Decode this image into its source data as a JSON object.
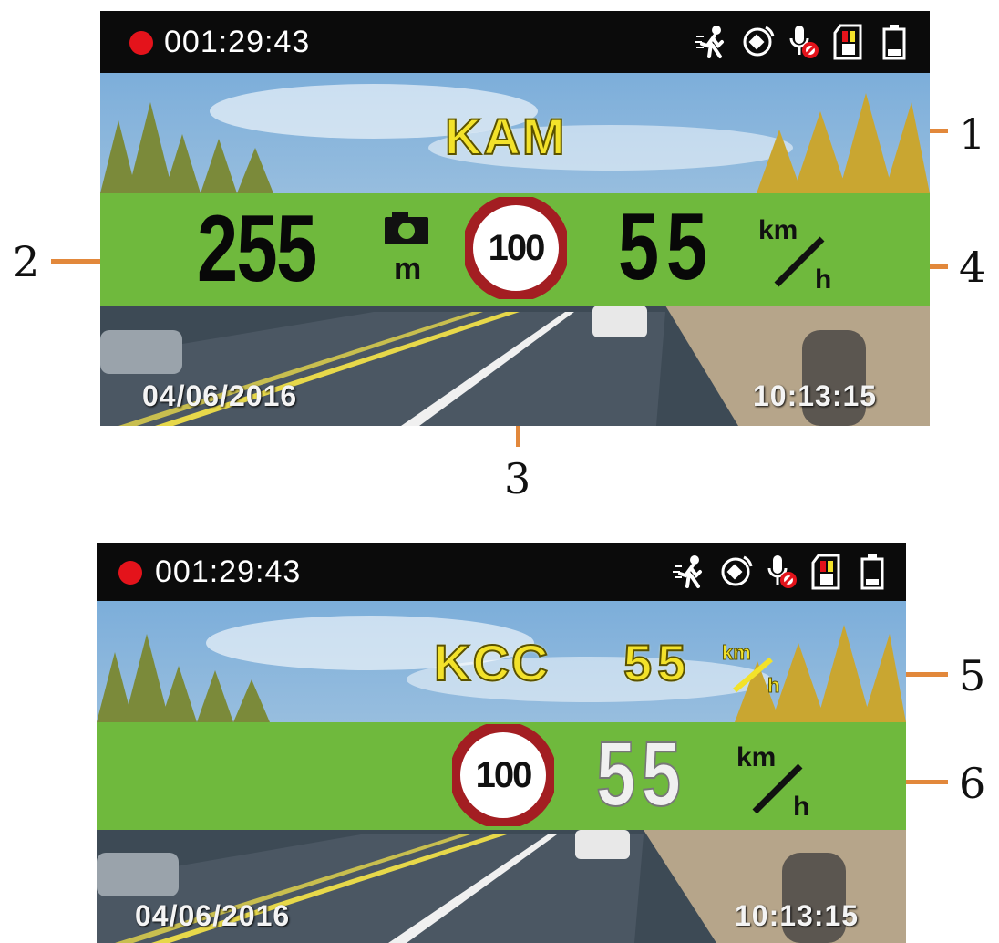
{
  "figure1": {
    "status": {
      "recording_time": "001:29:43",
      "icons": [
        "pedestrian-icon",
        "gps-satellite-icon",
        "microphone-muted-icon",
        "sd-card-icon",
        "battery-icon"
      ]
    },
    "alert_label": "KAM",
    "distance_value": "255",
    "distance_unit": "m",
    "speed_limit": "100",
    "current_speed": "55",
    "speed_unit_top": "km",
    "speed_unit_bottom": "h",
    "date": "04/06/2016",
    "time": "10:13:15"
  },
  "figure2": {
    "status": {
      "recording_time": "001:29:43",
      "icons": [
        "pedestrian-icon",
        "gps-satellite-icon",
        "microphone-muted-icon",
        "sd-card-icon",
        "battery-icon"
      ]
    },
    "alert_label": "KCC",
    "alert_speed": "55",
    "alert_speed_unit_top": "km",
    "alert_speed_unit_bottom": "h",
    "speed_limit": "100",
    "current_speed": "55",
    "speed_unit_top": "km",
    "speed_unit_bottom": "h",
    "date": "04/06/2016",
    "time": "10:13:15"
  },
  "callouts": [
    "1",
    "2",
    "3",
    "4",
    "5",
    "6"
  ],
  "colors": {
    "status_bar": "#0b0b0b",
    "record_dot": "#e4131b",
    "band_green": "#6fb93d",
    "alert_yellow": "#f3e22a",
    "sign_red": "#a31e22",
    "callout_orange": "#e2883b"
  }
}
